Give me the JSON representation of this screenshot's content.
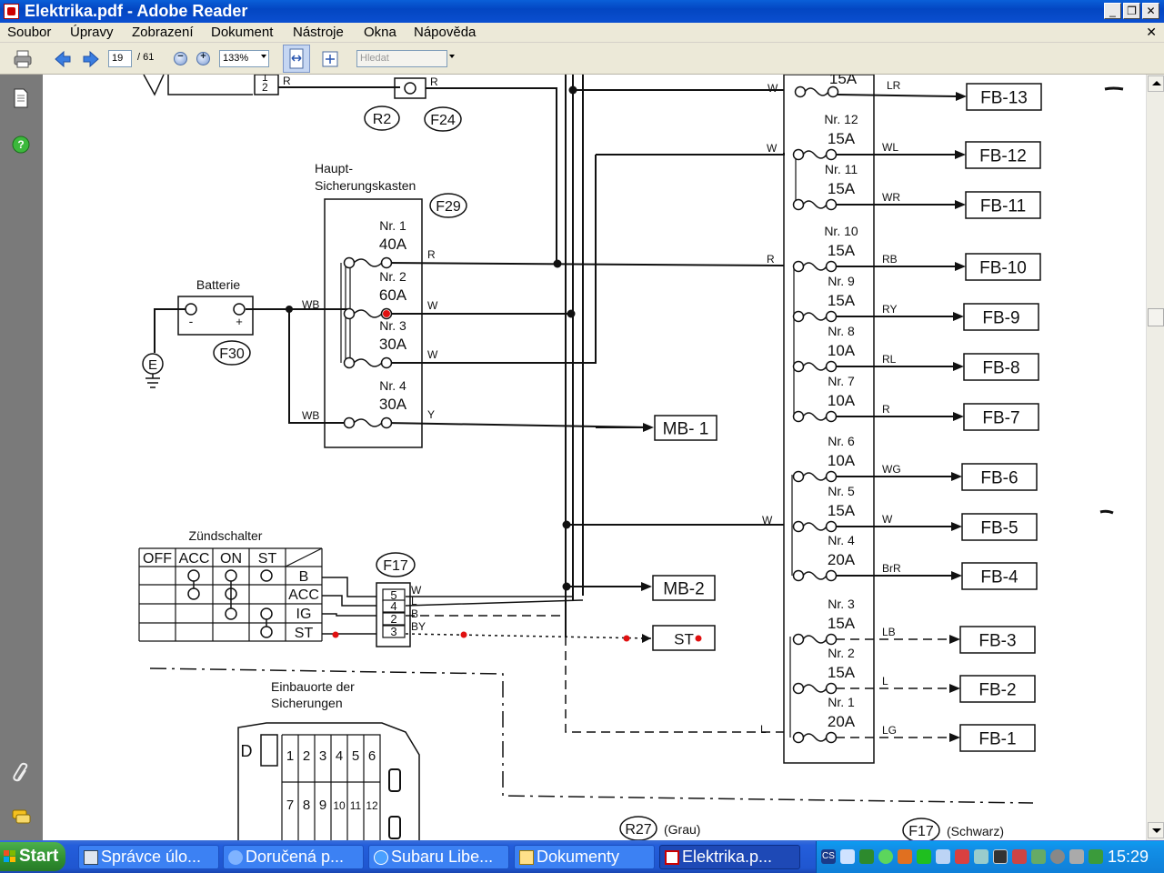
{
  "window": {
    "title": "Elektrika.pdf - Adobe Reader",
    "buttons": {
      "minimize": "_",
      "maximize": "❐",
      "close": "✕"
    }
  },
  "menu": {
    "items": [
      "Soubor",
      "Úpravy",
      "Zobrazení",
      "Dokument",
      "Nástroje",
      "Okna",
      "Nápověda"
    ],
    "doc_close": "✕"
  },
  "toolbar": {
    "page_current": "19",
    "page_total": "/ 61",
    "zoom": "133%",
    "search_placeholder": "Hledat",
    "zoom_out": "−",
    "zoom_in": "+"
  },
  "diagram": {
    "top_labels": {
      "fuse_nr13_rating": "15A",
      "r2": "R2",
      "f24": "F24",
      "wire_r_a": "R",
      "wire_r_b": "R",
      "num_2": "2",
      "num_1": "1"
    },
    "main_box": {
      "title_line1": "Haupt-",
      "title_line2": "Sicherungskasten",
      "ref": "F29"
    },
    "main_fuses": [
      {
        "nr": "Nr. 1",
        "rating": "40A",
        "wire": "R"
      },
      {
        "nr": "Nr. 2",
        "rating": "60A",
        "wire": "W"
      },
      {
        "nr": "Nr. 3",
        "rating": "30A",
        "wire": "W"
      },
      {
        "nr": "Nr. 4",
        "rating": "30A",
        "wire": "Y"
      }
    ],
    "battery": {
      "label": "Batterie",
      "ref": "F30",
      "minus": "-",
      "plus": "+",
      "wb1": "WB",
      "wb2": "WB",
      "ground": "E"
    },
    "mb_boxes": [
      "MB- 1",
      "MB-2",
      "ST"
    ],
    "ignition": {
      "title": "Zündschalter",
      "headers": [
        "OFF",
        "ACC",
        "ON",
        "ST"
      ],
      "rows": [
        "B",
        "ACC",
        "IG",
        "ST"
      ],
      "ref": "F17",
      "pins": [
        "5",
        "4",
        "2",
        "3"
      ],
      "pin_wires": [
        "W",
        "L",
        "B",
        "BY"
      ]
    },
    "right_fuses": [
      {
        "nr": "Nr. 12",
        "rating": "15A",
        "wire": "WL",
        "box": "FB-12"
      },
      {
        "nr": "Nr. 11",
        "rating": "15A",
        "wire": "WR",
        "box": "FB-11"
      },
      {
        "nr": "Nr. 10",
        "rating": "15A",
        "wire": "RB",
        "box": "FB-10"
      },
      {
        "nr": "Nr. 9",
        "rating": "15A",
        "wire": "RY",
        "box": "FB-9"
      },
      {
        "nr": "Nr. 8",
        "rating": "10A",
        "wire": "RL",
        "box": "FB-8"
      },
      {
        "nr": "Nr. 7",
        "rating": "10A",
        "wire": "R",
        "box": "FB-7"
      },
      {
        "nr": "Nr. 6",
        "rating": "10A",
        "wire": "WG",
        "box": "FB-6"
      },
      {
        "nr": "Nr. 5",
        "rating": "15A",
        "wire": "W",
        "box": "FB-5"
      },
      {
        "nr": "Nr. 4",
        "rating": "20A",
        "wire": "BrR",
        "box": "FB-4"
      },
      {
        "nr": "Nr. 3",
        "rating": "15A",
        "wire": "LB",
        "box": "FB-3"
      },
      {
        "nr": "Nr. 2",
        "rating": "15A",
        "wire": "L",
        "box": "FB-2"
      },
      {
        "nr": "Nr. 1",
        "rating": "20A",
        "wire": "LG",
        "box": "FB-1"
      }
    ],
    "fb13": {
      "wire": "LR",
      "box": "FB-13"
    },
    "input_wires": {
      "w_top": "W",
      "w_12": "W",
      "r_10": "R",
      "w_5": "W",
      "l_1": "L"
    },
    "location": {
      "title_line1": "Einbauorte der",
      "title_line2": "Sicherungen",
      "numbers_top": [
        "1",
        "2",
        "3",
        "4",
        "5",
        "6"
      ],
      "numbers_bottom": [
        "7",
        "8",
        "9",
        "10",
        "11",
        "12"
      ],
      "d_label": "D",
      "r27": "R27",
      "r27_text": "(Grau)",
      "f17": "F17",
      "f17_text": "(Schwarz)"
    }
  },
  "taskbar": {
    "start": "Start",
    "tasks": [
      "Správce úlo...",
      "Doručená p...",
      "Subaru Libe...",
      "Dokumenty",
      "Elektrika.p..."
    ],
    "clock": "15:29",
    "tray_text": "CS"
  },
  "colors": {
    "title_blue": "#0346c2",
    "taskbar_blue": "#245edb",
    "start_green": "#2f8f2f",
    "nav_gray": "#7a7a7a",
    "red_marker": "#e01010"
  }
}
